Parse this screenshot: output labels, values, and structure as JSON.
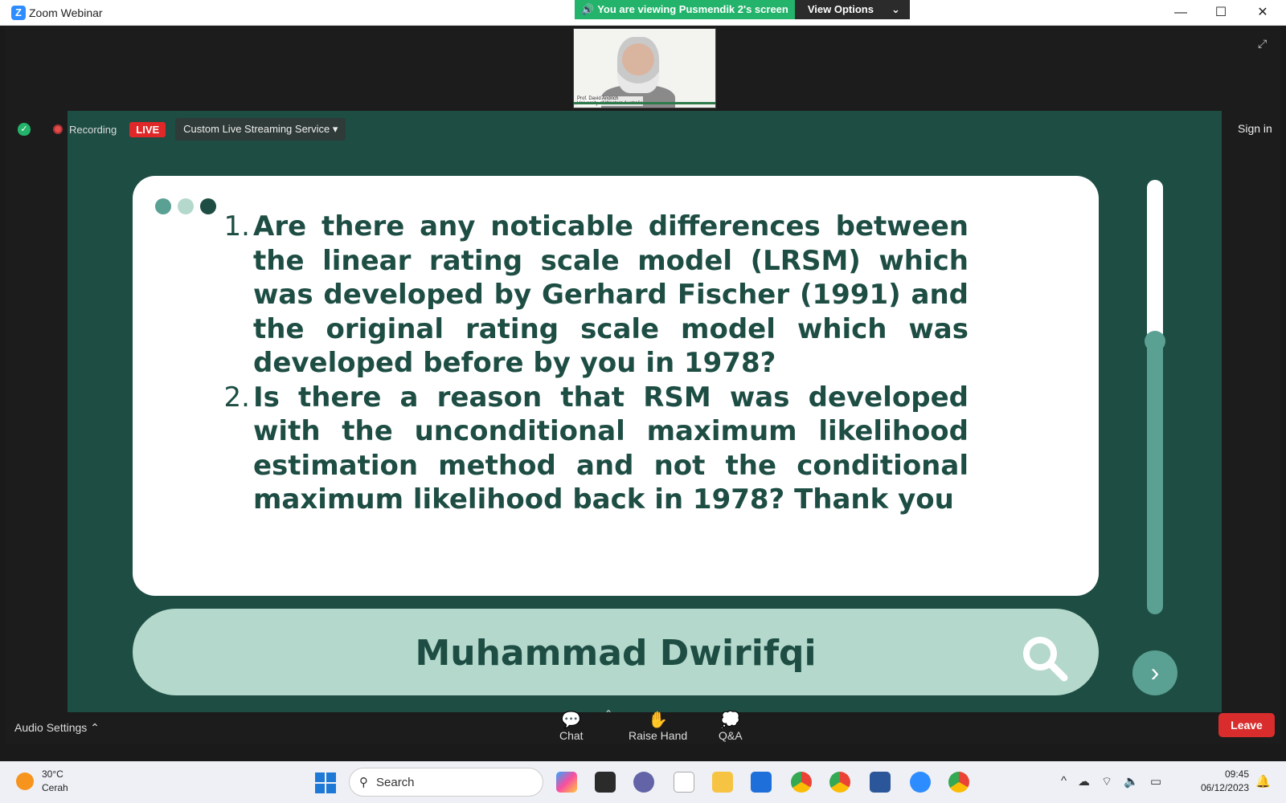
{
  "window": {
    "app_title": "Zoom Webinar",
    "minimize": "—",
    "maximize": "☐",
    "close": "✕"
  },
  "share_banner": {
    "viewing_text": "You are viewing Pusmendik 2's screen",
    "view_options": "View Options",
    "chevron": "⌄"
  },
  "thumbnail": {
    "caption": "Prof. David Andrich\nUniversity of Western Australia"
  },
  "status_strip": {
    "recording_label": "Recording",
    "live_label": "LIVE",
    "streaming_service": "Custom Live Streaming Service ▾",
    "sign_in": "Sign in"
  },
  "slide": {
    "dot_colors": [
      "#5aa093",
      "#b5d8cc",
      "#1d4d43"
    ],
    "questions": [
      {
        "num": "1.",
        "text": "Are there any noticable differences between the linear rating scale model (LRSM) which was developed by Gerhard Fischer (1991) and the original rating scale model which was developed before by you in 1978?"
      },
      {
        "num": "2.",
        "text": "Is there a reason that RSM was developed with the unconditional maximum likelihood estimation method and not the conditional maximum likelihood back in 1978? Thank you"
      }
    ],
    "asker_name": "Muhammad Dwirifqi",
    "next_glyph": "›"
  },
  "toolbar": {
    "audio_settings": "Audio Settings  ⌃",
    "chat": "Chat",
    "chat_caret": "⌃",
    "raise_hand": "Raise Hand",
    "qa": "Q&A",
    "leave": "Leave"
  },
  "taskbar": {
    "temperature": "30°C",
    "weather_desc": "Cerah",
    "search_placeholder": "Search",
    "time": "09:45",
    "date": "06/12/2023"
  }
}
